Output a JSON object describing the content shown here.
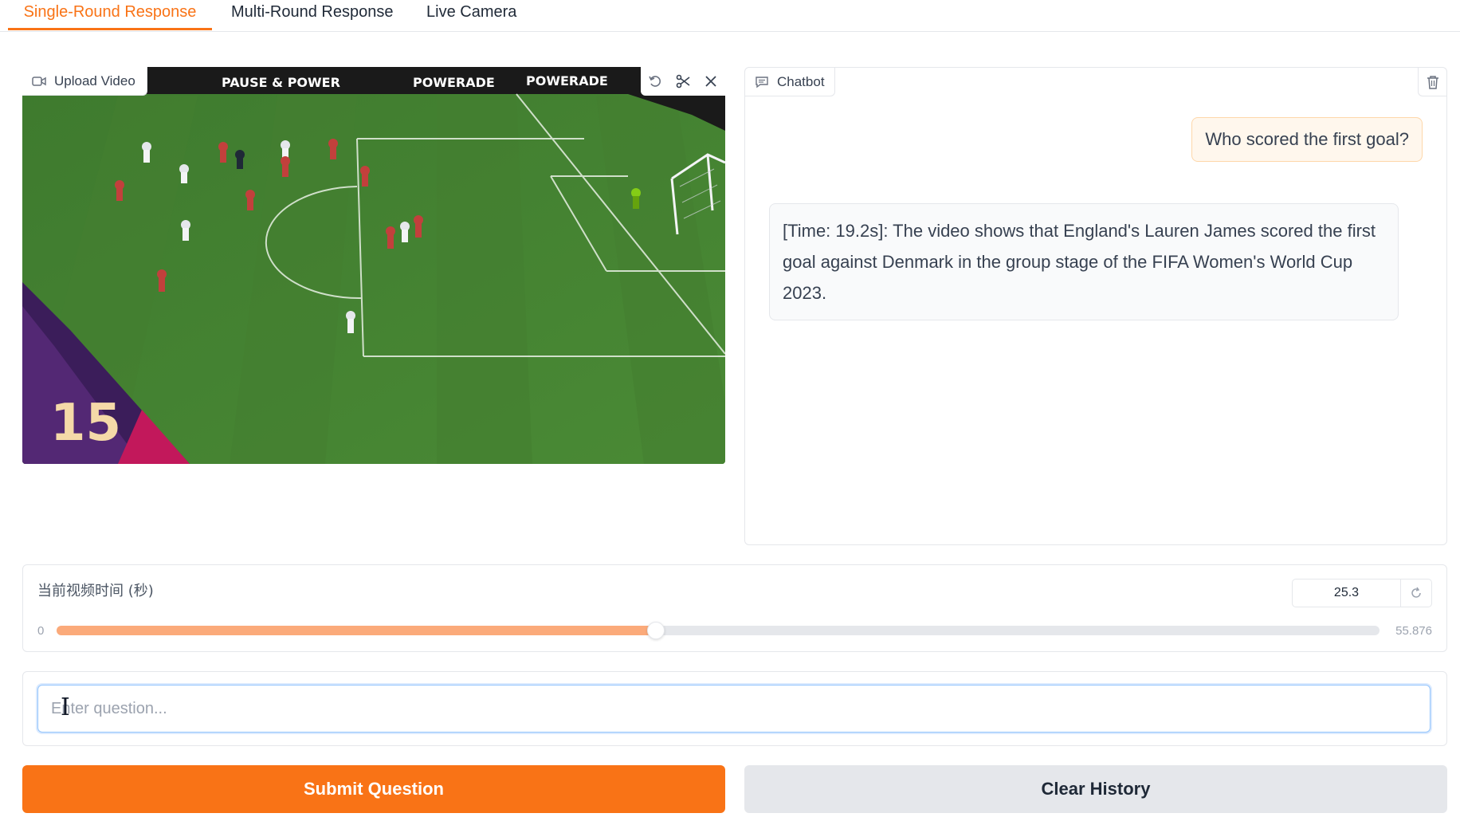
{
  "tabs": [
    {
      "label": "Single-Round Response",
      "active": true
    },
    {
      "label": "Multi-Round Response",
      "active": false
    },
    {
      "label": "Live Camera",
      "active": false
    }
  ],
  "video": {
    "label": "Upload Video",
    "icon": "video-camera-icon",
    "tools": [
      "undo-icon",
      "scissors-icon",
      "close-icon"
    ],
    "frame": {
      "banner": [
        "PAUSE & POWER",
        "POWERADE",
        "POWERADE"
      ],
      "clock": "15"
    }
  },
  "chatbot": {
    "label": "Chatbot",
    "icon": "chat-icon",
    "clear_icon": "trash-icon",
    "messages": [
      {
        "role": "user",
        "text": "Who scored the first goal?"
      },
      {
        "role": "bot",
        "text": "[Time: 19.2s]: The video shows that England's Lauren James scored the first goal against Denmark in the group stage of the FIFA Women's World Cup 2023."
      }
    ]
  },
  "slider": {
    "label": "当前视频时间 (秒)",
    "value": "25.3",
    "min": "0",
    "max": "55.876",
    "fraction": 0.453
  },
  "question": {
    "placeholder": "Enter question...",
    "value": ""
  },
  "buttons": {
    "submit": "Submit Question",
    "clear": "Clear History"
  },
  "colors": {
    "accent": "#f97316",
    "slider_fill": "#fbaa7a",
    "user_bubble": "#fff7ed"
  }
}
